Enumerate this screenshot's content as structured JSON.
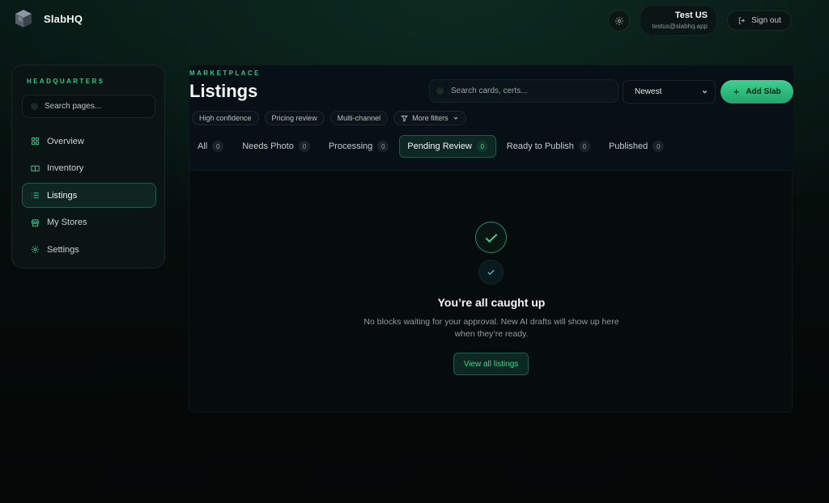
{
  "app": {
    "name": "SlabHQ"
  },
  "user": {
    "name": "Test US",
    "email": "testus@slabhq.app",
    "sign_out_label": "Sign out"
  },
  "sidebar": {
    "title": "HEADQUARTERS",
    "search_placeholder": "Search pages...",
    "items": [
      {
        "label": "Overview",
        "icon": "grid-icon",
        "active": false
      },
      {
        "label": "Inventory",
        "icon": "book-icon",
        "active": false
      },
      {
        "label": "Listings",
        "icon": "list-icon",
        "active": true
      },
      {
        "label": "My Stores",
        "icon": "store-icon",
        "active": false
      },
      {
        "label": "Settings",
        "icon": "gear-icon",
        "active": false
      }
    ]
  },
  "header": {
    "eyebrow": "MARKETPLACE",
    "title": "Listings",
    "search_placeholder": "Search cards, certs...",
    "sort_value": "Newest",
    "add_label": "Add Slab",
    "chips": [
      "High confidence",
      "Pricing review",
      "Multi-channel"
    ],
    "more_filters_label": "More filters"
  },
  "tabs": [
    {
      "label": "All",
      "count": "0",
      "active": false
    },
    {
      "label": "Needs Photo",
      "count": "0",
      "active": false
    },
    {
      "label": "Processing",
      "count": "0",
      "active": false
    },
    {
      "label": "Pending Review",
      "count": "0",
      "active": true
    },
    {
      "label": "Ready to Publish",
      "count": "0",
      "active": false
    },
    {
      "label": "Published",
      "count": "0",
      "active": false
    }
  ],
  "empty_state": {
    "title": "You’re all caught up",
    "text": "No blocks waiting for your approval. New AI drafts will show up here when they’re ready.",
    "button_label": "View all listings"
  },
  "colors": {
    "accent": "#35c58a",
    "button_gradient_top": "#3ed092",
    "button_gradient_bottom": "#22a46b",
    "background": "#06100d"
  }
}
